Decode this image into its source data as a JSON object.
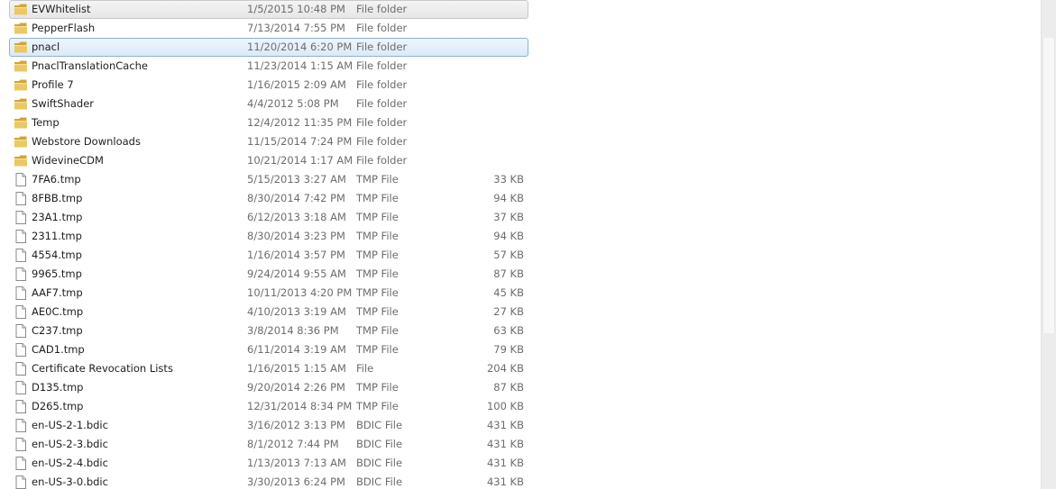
{
  "files": [
    {
      "name": "EVWhitelist",
      "date": "1/5/2015 10:48 PM",
      "type": "File folder",
      "size": "",
      "kind": "folder",
      "state": "hover"
    },
    {
      "name": "PepperFlash",
      "date": "7/13/2014 7:55 PM",
      "type": "File folder",
      "size": "",
      "kind": "folder",
      "state": ""
    },
    {
      "name": "pnacl",
      "date": "11/20/2014 6:20 PM",
      "type": "File folder",
      "size": "",
      "kind": "folder",
      "state": "selected"
    },
    {
      "name": "PnaclTranslationCache",
      "date": "11/23/2014 1:15 AM",
      "type": "File folder",
      "size": "",
      "kind": "folder",
      "state": ""
    },
    {
      "name": "Profile 7",
      "date": "1/16/2015 2:09 AM",
      "type": "File folder",
      "size": "",
      "kind": "folder",
      "state": ""
    },
    {
      "name": "SwiftShader",
      "date": "4/4/2012 5:08 PM",
      "type": "File folder",
      "size": "",
      "kind": "folder",
      "state": ""
    },
    {
      "name": "Temp",
      "date": "12/4/2012 11:35 PM",
      "type": "File folder",
      "size": "",
      "kind": "folder",
      "state": ""
    },
    {
      "name": "Webstore Downloads",
      "date": "11/15/2014 7:24 PM",
      "type": "File folder",
      "size": "",
      "kind": "folder",
      "state": ""
    },
    {
      "name": "WidevineCDM",
      "date": "10/21/2014 1:17 AM",
      "type": "File folder",
      "size": "",
      "kind": "folder",
      "state": ""
    },
    {
      "name": "7FA6.tmp",
      "date": "5/15/2013 3:27 AM",
      "type": "TMP File",
      "size": "33 KB",
      "kind": "file",
      "state": ""
    },
    {
      "name": "8FBB.tmp",
      "date": "8/30/2014 7:42 PM",
      "type": "TMP File",
      "size": "94 KB",
      "kind": "file",
      "state": ""
    },
    {
      "name": "23A1.tmp",
      "date": "6/12/2013 3:18 AM",
      "type": "TMP File",
      "size": "37 KB",
      "kind": "file",
      "state": ""
    },
    {
      "name": "2311.tmp",
      "date": "8/30/2014 3:23 PM",
      "type": "TMP File",
      "size": "94 KB",
      "kind": "file",
      "state": ""
    },
    {
      "name": "4554.tmp",
      "date": "1/16/2014 3:57 PM",
      "type": "TMP File",
      "size": "57 KB",
      "kind": "file",
      "state": ""
    },
    {
      "name": "9965.tmp",
      "date": "9/24/2014 9:55 AM",
      "type": "TMP File",
      "size": "87 KB",
      "kind": "file",
      "state": ""
    },
    {
      "name": "AAF7.tmp",
      "date": "10/11/2013 4:20 PM",
      "type": "TMP File",
      "size": "45 KB",
      "kind": "file",
      "state": ""
    },
    {
      "name": "AE0C.tmp",
      "date": "4/10/2013 3:19 AM",
      "type": "TMP File",
      "size": "27 KB",
      "kind": "file",
      "state": ""
    },
    {
      "name": "C237.tmp",
      "date": "3/8/2014 8:36 PM",
      "type": "TMP File",
      "size": "63 KB",
      "kind": "file",
      "state": ""
    },
    {
      "name": "CAD1.tmp",
      "date": "6/11/2014 3:19 AM",
      "type": "TMP File",
      "size": "79 KB",
      "kind": "file",
      "state": ""
    },
    {
      "name": "Certificate Revocation Lists",
      "date": "1/16/2015 1:15 AM",
      "type": "File",
      "size": "204 KB",
      "kind": "file",
      "state": ""
    },
    {
      "name": "D135.tmp",
      "date": "9/20/2014 2:26 PM",
      "type": "TMP File",
      "size": "87 KB",
      "kind": "file",
      "state": ""
    },
    {
      "name": "D265.tmp",
      "date": "12/31/2014 8:34 PM",
      "type": "TMP File",
      "size": "100 KB",
      "kind": "file",
      "state": ""
    },
    {
      "name": "en-US-2-1.bdic",
      "date": "3/16/2012 3:13 PM",
      "type": "BDIC File",
      "size": "431 KB",
      "kind": "file",
      "state": ""
    },
    {
      "name": "en-US-2-3.bdic",
      "date": "8/1/2012 7:44 PM",
      "type": "BDIC File",
      "size": "431 KB",
      "kind": "file",
      "state": ""
    },
    {
      "name": "en-US-2-4.bdic",
      "date": "1/13/2013 7:13 AM",
      "type": "BDIC File",
      "size": "431 KB",
      "kind": "file",
      "state": ""
    },
    {
      "name": "en-US-3-0.bdic",
      "date": "3/30/2013 6:24 PM",
      "type": "BDIC File",
      "size": "431 KB",
      "kind": "file",
      "state": ""
    }
  ],
  "icons": {
    "folder": "folder-icon",
    "file": "file-icon"
  },
  "colors": {
    "folder_yellow": "#e8c25a",
    "selection_border": "#8fb0d6",
    "detail_text": "#6d6d6d"
  }
}
